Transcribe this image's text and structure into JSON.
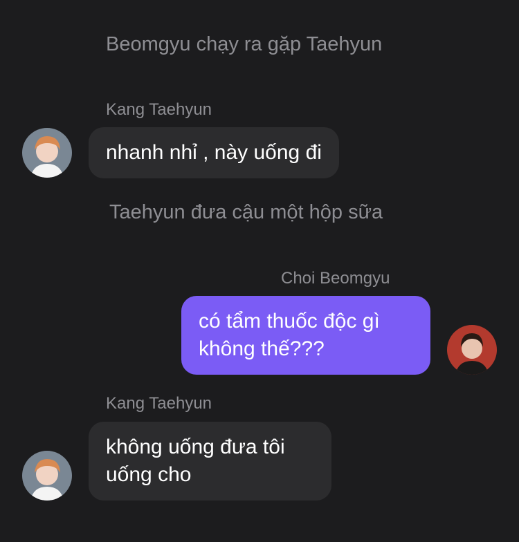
{
  "colors": {
    "background": "#1c1c1e",
    "incoming_bubble": "#2c2c2e",
    "outgoing_bubble": "#7b5cf5",
    "secondary_text": "#8e8e93"
  },
  "conversation": [
    {
      "type": "narration",
      "text": "Beomgyu chạy ra gặp Taehyun"
    },
    {
      "type": "incoming",
      "sender": "Kang Taehyun",
      "avatar": "avatar-kang-taehyun",
      "text": "nhanh nhỉ , này uống đi"
    },
    {
      "type": "narration",
      "text": "Taehyun đưa cậu một hộp sữa"
    },
    {
      "type": "outgoing",
      "sender": "Choi Beomgyu",
      "avatar": "avatar-choi-beomgyu",
      "lines": [
        "có tẩm thuốc độc gì",
        "không thế???"
      ]
    },
    {
      "type": "incoming",
      "sender": "Kang Taehyun",
      "avatar": "avatar-kang-taehyun",
      "lines": [
        "không uống đưa tôi",
        "uống cho"
      ]
    }
  ]
}
